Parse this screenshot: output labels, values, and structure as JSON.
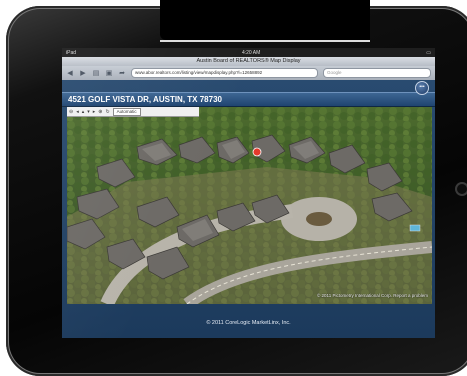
{
  "status_bar": {
    "carrier": "iPad",
    "time": "4:20 AM"
  },
  "browser": {
    "page_title": "Austin Board of REALTORS® Map Display",
    "url": "www.abor.realtors.com/listing/view/mapdisplay.php?l=12658892",
    "search_placeholder": "Google"
  },
  "listing": {
    "address": "4521 GOLF VISTA DR, AUSTIN, TX 78730"
  },
  "map": {
    "view_mode": "Automatic",
    "attribution": "© 2011 Pictometry International Corp.  Report a problem",
    "marker_color": "#e53b2c"
  },
  "footer": {
    "copyright": "© 2011 CoreLogic MarketLinx, Inc."
  },
  "icons": {
    "back": "chevron-left-icon",
    "forward": "chevron-right-icon",
    "bookmarks": "book-icon",
    "tabs": "pages-icon",
    "share": "share-icon",
    "more": "more-icon"
  }
}
